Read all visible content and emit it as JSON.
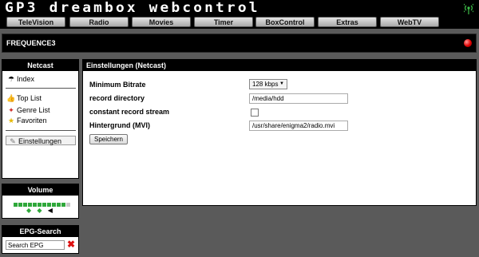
{
  "header": {
    "logo_text": "GP3 dreambox webcontrol",
    "nav": [
      "TeleVision",
      "Radio",
      "Movies",
      "Timer",
      "BoxControl",
      "Extras",
      "WebTV"
    ]
  },
  "channel": {
    "name": "FREQUENCE3"
  },
  "sidebar": {
    "netcast": {
      "title": "Netcast",
      "items": [
        "Index",
        "Top List",
        "Genre List",
        "Favoriten",
        "Einstellungen"
      ]
    },
    "volume": {
      "title": "Volume",
      "level_fraction": 0.9
    },
    "epg": {
      "title": "EPG-Search",
      "input_value": "Search EPG"
    }
  },
  "main": {
    "title": "Einstellungen (Netcast)",
    "bitrate_label": "Minimum Bitrate",
    "bitrate_value": "128 kbps",
    "record_dir_label": "record directory",
    "record_dir_value": "/media/hdd",
    "constant_stream_label": "constant record stream",
    "constant_stream_checked": false,
    "background_label": "Hintergrund (MVI)",
    "background_value": "/usr/share/enigma2/radio.mvi",
    "save_label": "Speichern"
  },
  "colors": {
    "accent_green": "#2fa83a",
    "rec_red": "#e00000"
  }
}
